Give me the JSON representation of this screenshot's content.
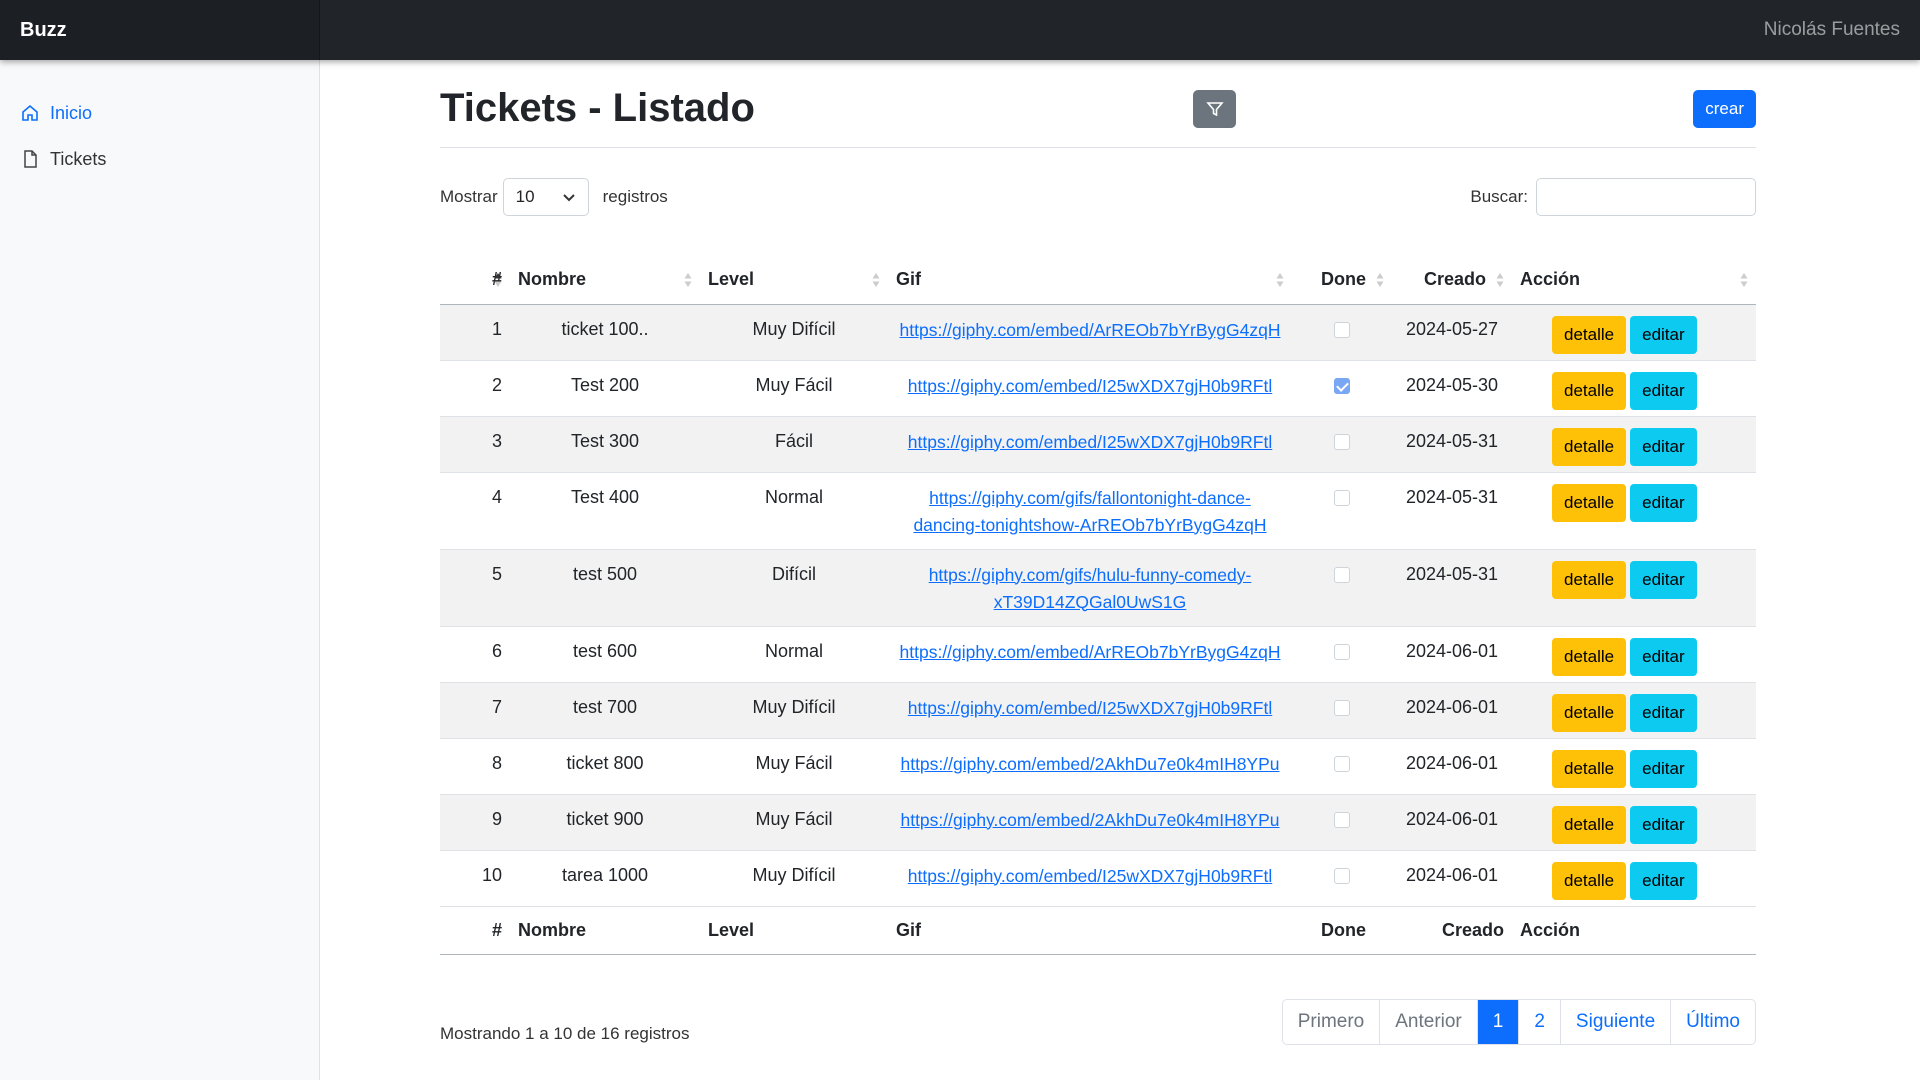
{
  "app": {
    "brand": "Buzz",
    "user": "Nicolás Fuentes"
  },
  "sidebar": {
    "items": [
      {
        "label": "Inicio",
        "icon": "home-icon",
        "active": true
      },
      {
        "label": "Tickets",
        "icon": "file-icon",
        "active": false
      }
    ]
  },
  "page": {
    "title": "Tickets - Listado",
    "create_label": "crear"
  },
  "controls": {
    "show_label": "Mostrar",
    "page_size": "10",
    "records_label": "registros",
    "search_label": "Buscar:",
    "search_value": ""
  },
  "table": {
    "headers": {
      "num": "#",
      "name": "Nombre",
      "level": "Level",
      "gif": "Gif",
      "done": "Done",
      "created": "Creado",
      "action": "Acción"
    },
    "rows": [
      {
        "num": "1",
        "name": "ticket 100..",
        "level": "Muy Difícil",
        "gif": "https://giphy.com/embed/ArREOb7bYrBygG4zqH",
        "done": false,
        "created": "2024-05-27"
      },
      {
        "num": "2",
        "name": "Test 200",
        "level": "Muy Fácil",
        "gif": "https://giphy.com/embed/I25wXDX7gjH0b9RFtl",
        "done": true,
        "created": "2024-05-30"
      },
      {
        "num": "3",
        "name": "Test 300",
        "level": "Fácil",
        "gif": "https://giphy.com/embed/I25wXDX7gjH0b9RFtl",
        "done": false,
        "created": "2024-05-31"
      },
      {
        "num": "4",
        "name": "Test 400",
        "level": "Normal",
        "gif": "https://giphy.com/gifs/fallontonight-dance-dancing-tonightshow-ArREOb7bYrBygG4zqH",
        "done": false,
        "created": "2024-05-31"
      },
      {
        "num": "5",
        "name": "test 500",
        "level": "Difícil",
        "gif": "https://giphy.com/gifs/hulu-funny-comedy-xT39D14ZQGal0UwS1G",
        "done": false,
        "created": "2024-05-31"
      },
      {
        "num": "6",
        "name": "test 600",
        "level": "Normal",
        "gif": "https://giphy.com/embed/ArREOb7bYrBygG4zqH",
        "done": false,
        "created": "2024-06-01"
      },
      {
        "num": "7",
        "name": "test 700",
        "level": "Muy Difícil",
        "gif": "https://giphy.com/embed/I25wXDX7gjH0b9RFtl",
        "done": false,
        "created": "2024-06-01"
      },
      {
        "num": "8",
        "name": "ticket 800",
        "level": "Muy Fácil",
        "gif": "https://giphy.com/embed/2AkhDu7e0k4mIH8YPu",
        "done": false,
        "created": "2024-06-01"
      },
      {
        "num": "9",
        "name": "ticket 900",
        "level": "Muy Fácil",
        "gif": "https://giphy.com/embed/2AkhDu7e0k4mIH8YPu",
        "done": false,
        "created": "2024-06-01"
      },
      {
        "num": "10",
        "name": "tarea 1000",
        "level": "Muy Difícil",
        "gif": "https://giphy.com/embed/I25wXDX7gjH0b9RFtl",
        "done": false,
        "created": "2024-06-01"
      }
    ],
    "detail_label": "detalle",
    "edit_label": "editar"
  },
  "pagination": {
    "info": "Mostrando 1 a 10 de 16 registros",
    "first": "Primero",
    "prev": "Anterior",
    "pages": [
      "1",
      "2"
    ],
    "current": "1",
    "next": "Siguiente",
    "last": "Último"
  },
  "colors": {
    "primary": "#0d6efd",
    "warning": "#ffc107",
    "info": "#0dcaf0",
    "secondary": "#6c757d",
    "navbar": "#212529"
  }
}
